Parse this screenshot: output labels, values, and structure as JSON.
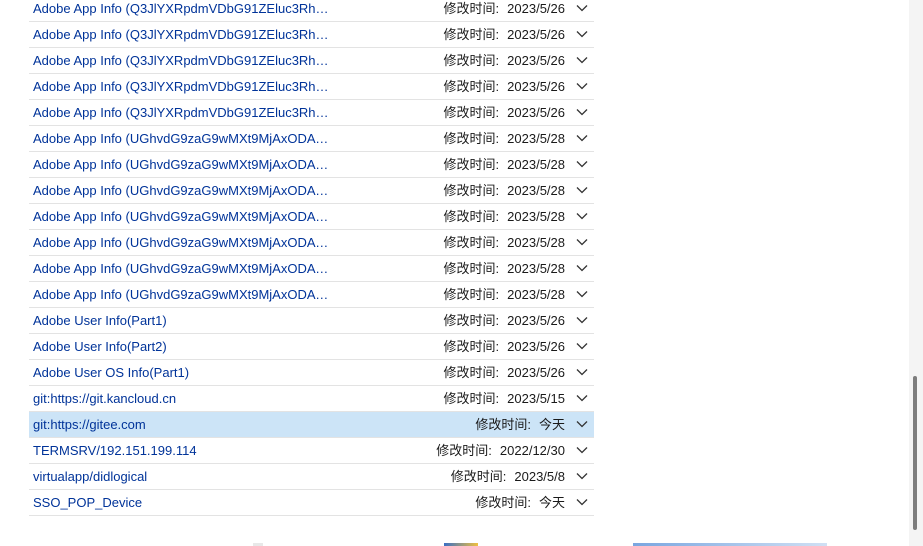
{
  "list": {
    "rows": [
      {
        "name": "Adobe App Info (Q3JlYXRpdmVDbG91ZEluc3RhbGxlcg...)",
        "label": "修改时间:",
        "date": "2023/5/26",
        "selected": false
      },
      {
        "name": "Adobe App Info (Q3JlYXRpdmVDbG91ZEluc3RhbGxlcg...)",
        "label": "修改时间:",
        "date": "2023/5/26",
        "selected": false
      },
      {
        "name": "Adobe App Info (Q3JlYXRpdmVDbG91ZEluc3RhbGxlcg...)",
        "label": "修改时间:",
        "date": "2023/5/26",
        "selected": false
      },
      {
        "name": "Adobe App Info (Q3JlYXRpdmVDbG91ZEluc3RhbGxlcg...)",
        "label": "修改时间:",
        "date": "2023/5/26",
        "selected": false
      },
      {
        "name": "Adobe App Info (Q3JlYXRpdmVDbG91ZEluc3RhbGxlcg...)",
        "label": "修改时间:",
        "date": "2023/5/26",
        "selected": false
      },
      {
        "name": "Adobe App Info (UGhvdG9zaG9wMXt9MjAxODAwMDAwMDAw...)",
        "label": "修改时间:",
        "date": "2023/5/28",
        "selected": false
      },
      {
        "name": "Adobe App Info (UGhvdG9zaG9wMXt9MjAxODAwMDAwMDAw...)",
        "label": "修改时间:",
        "date": "2023/5/28",
        "selected": false
      },
      {
        "name": "Adobe App Info (UGhvdG9zaG9wMXt9MjAxODAwMDAwMDAw...)",
        "label": "修改时间:",
        "date": "2023/5/28",
        "selected": false
      },
      {
        "name": "Adobe App Info (UGhvdG9zaG9wMXt9MjAxODAwMDAwMDAw...)",
        "label": "修改时间:",
        "date": "2023/5/28",
        "selected": false
      },
      {
        "name": "Adobe App Info (UGhvdG9zaG9wMXt9MjAxODAwMDAwMDAw...)",
        "label": "修改时间:",
        "date": "2023/5/28",
        "selected": false
      },
      {
        "name": "Adobe App Info (UGhvdG9zaG9wMXt9MjAxODAwMDAwMDAw...)",
        "label": "修改时间:",
        "date": "2023/5/28",
        "selected": false
      },
      {
        "name": "Adobe App Info (UGhvdG9zaG9wMXt9MjAxODAwMDAwMDAw...)",
        "label": "修改时间:",
        "date": "2023/5/28",
        "selected": false
      },
      {
        "name": "Adobe User Info(Part1)",
        "label": "修改时间:",
        "date": "2023/5/26",
        "selected": false
      },
      {
        "name": "Adobe User Info(Part2)",
        "label": "修改时间:",
        "date": "2023/5/26",
        "selected": false
      },
      {
        "name": "Adobe User OS Info(Part1)",
        "label": "修改时间:",
        "date": "2023/5/26",
        "selected": false
      },
      {
        "name": "git:https://git.kancloud.cn",
        "label": "修改时间:",
        "date": "2023/5/15",
        "selected": false
      },
      {
        "name": "git:https://gitee.com",
        "label": "修改时间:",
        "date": "今天",
        "selected": true
      },
      {
        "name": "TERMSRV/192.151.199.114",
        "label": "修改时间:",
        "date": "2022/12/30",
        "selected": false
      },
      {
        "name": "virtualapp/didlogical",
        "label": "修改时间:",
        "date": "2023/5/8",
        "selected": false
      },
      {
        "name": "SSO_POP_Device",
        "label": "修改时间:",
        "date": "今天",
        "selected": false
      }
    ]
  },
  "icons": {
    "expand": "chevron-down-icon"
  },
  "colors": {
    "link": "#003399",
    "selected_bg": "#cce4f7",
    "divider": "#e3e3e3",
    "scroll_thumb": "#7d7d7d"
  }
}
